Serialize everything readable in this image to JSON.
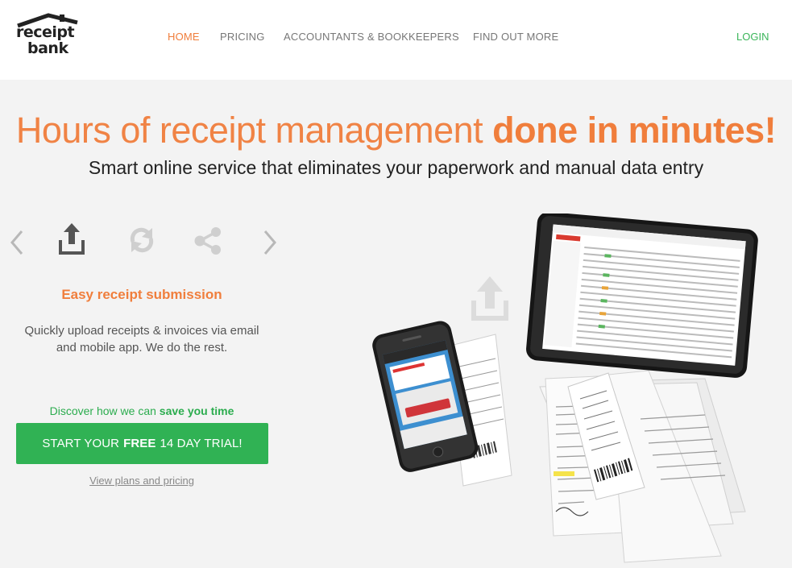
{
  "brand": {
    "logo_line1": "receipt",
    "logo_line2": "bank"
  },
  "nav": {
    "items": [
      {
        "label": "HOME",
        "active": true
      },
      {
        "label": "PRICING",
        "active": false
      },
      {
        "label": "ACCOUNTANTS & BOOKKEEPERS",
        "active": false
      },
      {
        "label": "FIND OUT MORE",
        "active": false
      }
    ],
    "login_label": "LOGIN"
  },
  "hero": {
    "title_light": "Hours of receipt management",
    "title_bold": "done in minutes!",
    "subtitle": "Smart online service that eliminates your paperwork and manual data entry"
  },
  "carousel": {
    "icons": [
      "chevron-left-icon",
      "upload-icon",
      "sync-icon",
      "share-icon",
      "chevron-right-icon"
    ],
    "active_index": 0,
    "feature_title": "Easy receipt submission",
    "feature_desc": "Quickly upload receipts & invoices via email and mobile app. We do the rest."
  },
  "cta": {
    "discover_prefix": "Discover how we can",
    "discover_bold": "save you time",
    "trial_prefix": "START YOUR",
    "trial_bold": "FREE",
    "trial_suffix": "14 DAY TRIAL!",
    "plans_link": "View plans and pricing"
  },
  "colors": {
    "accent": "#f07e3c",
    "green": "#30b254",
    "background": "#f3f3f3"
  }
}
